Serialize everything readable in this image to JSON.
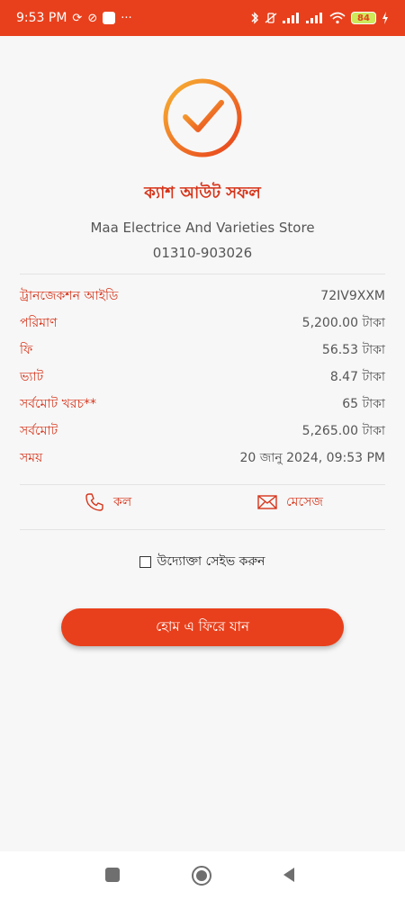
{
  "status_bar": {
    "time": "9:53 PM",
    "more": "···",
    "battery": "84"
  },
  "header": {
    "title": "ক্যাশ আউট সফল",
    "store_name": "Maa Electrice And Varieties Store",
    "store_phone": "01310-903026"
  },
  "details": [
    {
      "label": "ট্রানজেকশন আইডি",
      "value": "72IV9XXM"
    },
    {
      "label": "পরিমাণ",
      "value": "5,200.00 টাকা"
    },
    {
      "label": "ফি",
      "value": "56.53 টাকা"
    },
    {
      "label": "ভ্যাট",
      "value": "8.47 টাকা"
    },
    {
      "label": "সর্বমোট খরচ**",
      "value": "65 টাকা"
    },
    {
      "label": "সর্বমোট",
      "value": "5,265.00 টাকা"
    },
    {
      "label": "সময়",
      "value": "20 জানু 2024, 09:53 PM"
    }
  ],
  "actions": {
    "call_label": "কল",
    "message_label": "মেসেজ"
  },
  "save": {
    "label": "উদ্যোক্তা সেইভ করুন",
    "checked": false
  },
  "home_button": {
    "label": "হোম এ ফিরে যান"
  },
  "colors": {
    "accent": "#e8401c",
    "label_red": "#d6341a",
    "check_gradient_start": "#f7b233",
    "check_gradient_end": "#e8401c"
  }
}
